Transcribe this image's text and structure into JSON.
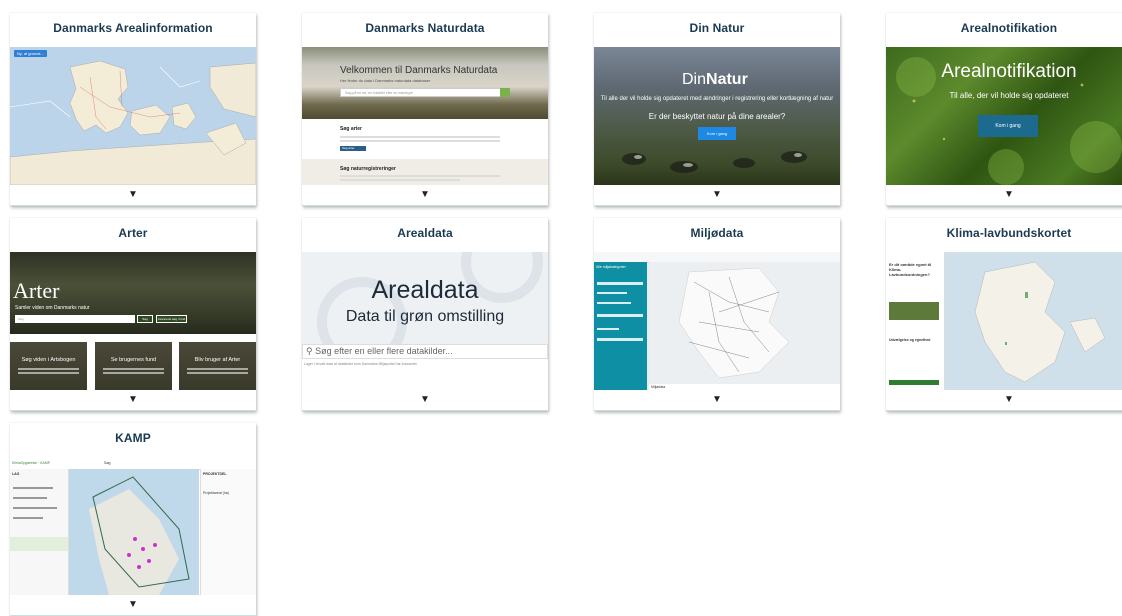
{
  "cards": [
    {
      "title": "Danmarks Arealinformation",
      "tag": "Ny. af grunds..."
    },
    {
      "title": "Danmarks Naturdata",
      "hero_title": "Velkommen til Danmarks Naturdata",
      "hero_sub": "Her finder du data i Danmarks naturdata databaser",
      "search_placeholder": "Søg på en art, en lokalitet eller en naturtype",
      "section1": "Søg arter",
      "section1_btn": "Søg arter",
      "section2": "Søg naturregistreringer"
    },
    {
      "title": "Din Natur",
      "logo_light": "Din",
      "logo_bold": "Natur",
      "sub1": "Til alle der vil holde sig opdateret med ændringer i registrering eller kortlægning af natur",
      "sub2": "Er der beskyttet natur på dine arealer?",
      "btn": "Kom i gang"
    },
    {
      "title": "Arealnotifikation",
      "big": "Arealnotifikation",
      "sub": "Til alle, der vil holde sig opdateret",
      "btn": "Kom i gang"
    },
    {
      "title": "Arter",
      "big": "Arter",
      "sub": "Samler viden om Danmarks natur",
      "search": "Søg",
      "btn1": "Søg",
      "btn2": "Avanceret søg i fund",
      "tiles": [
        "Søg viden i Artsbogen",
        "Se brugernes fund",
        "Bliv bruger af Arter"
      ]
    },
    {
      "title": "Arealdata",
      "big": "Arealdata",
      "sub": "Data til grøn omstilling",
      "search": "Søg efter en eller flere datakilder...",
      "tiny": "Lager i forvalt data af datakilder som Danmarks Miljøportal har indsamlet"
    },
    {
      "title": "Miljødata",
      "side_head": "Alle miljøkategorier",
      "layer": "Miljødata"
    },
    {
      "title": "Klima-lavbundskortet",
      "left_title": "Er dit område egnet til Klima-Lavbundsordningen?",
      "left_sub": "Udvælgelse og egnethed"
    },
    {
      "title": "KAMP",
      "app": "KlimaOpgørelse · KAMP",
      "search": "Søg",
      "panel": "PROJEKTDEL",
      "left_head": "LAG",
      "area": "Projektareal (ha)"
    }
  ],
  "toggle_icon": "▼",
  "colors": {
    "title": "#1a3a52",
    "mil_side": "#0e8fa3",
    "kamp_poly": "#cc33cc"
  }
}
